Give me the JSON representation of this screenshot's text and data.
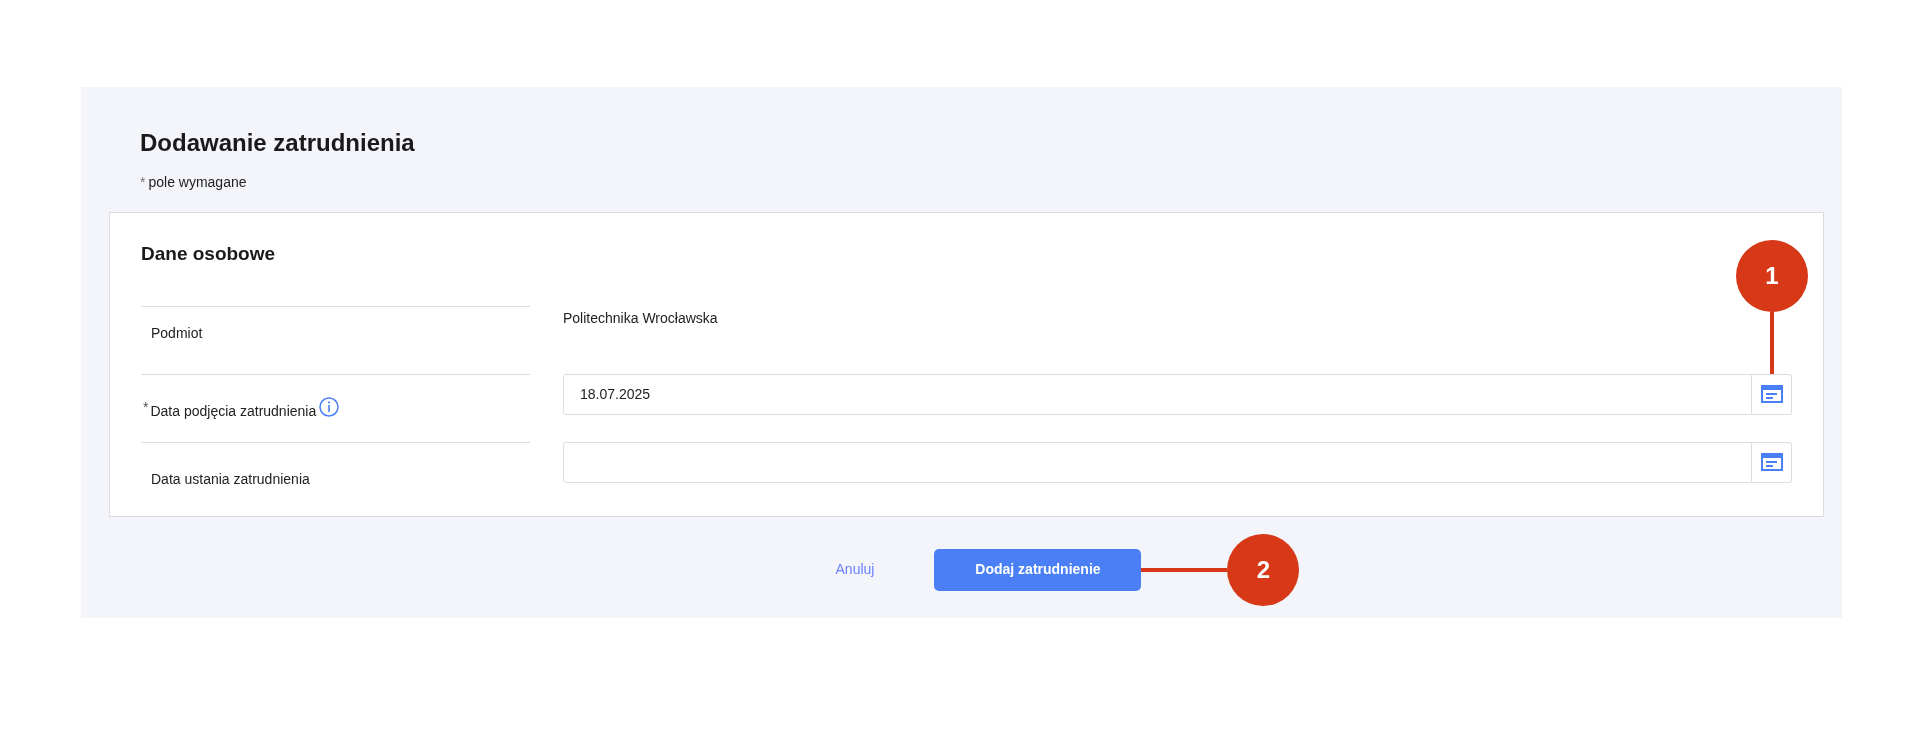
{
  "title": "Dodawanie zatrudnienia",
  "required_note": {
    "mark": "*",
    "text": "pole wymagane"
  },
  "section": {
    "title": "Dane osobowe",
    "fields": [
      {
        "kind": "text",
        "label": "Podmiot",
        "value": "Politechnika Wrocławska"
      },
      {
        "kind": "date",
        "label": "Data podjęcia zatrudnienia",
        "required_mark": "*",
        "info": true,
        "value": "18.07.2025"
      },
      {
        "kind": "date",
        "label": "Data ustania zatrudnienia"
      }
    ]
  },
  "buttons": {
    "cancel": "Anuluj",
    "submit": "Dodaj zatrudnienie"
  },
  "callouts": [
    {
      "number": "1"
    },
    {
      "number": "2"
    }
  ]
}
